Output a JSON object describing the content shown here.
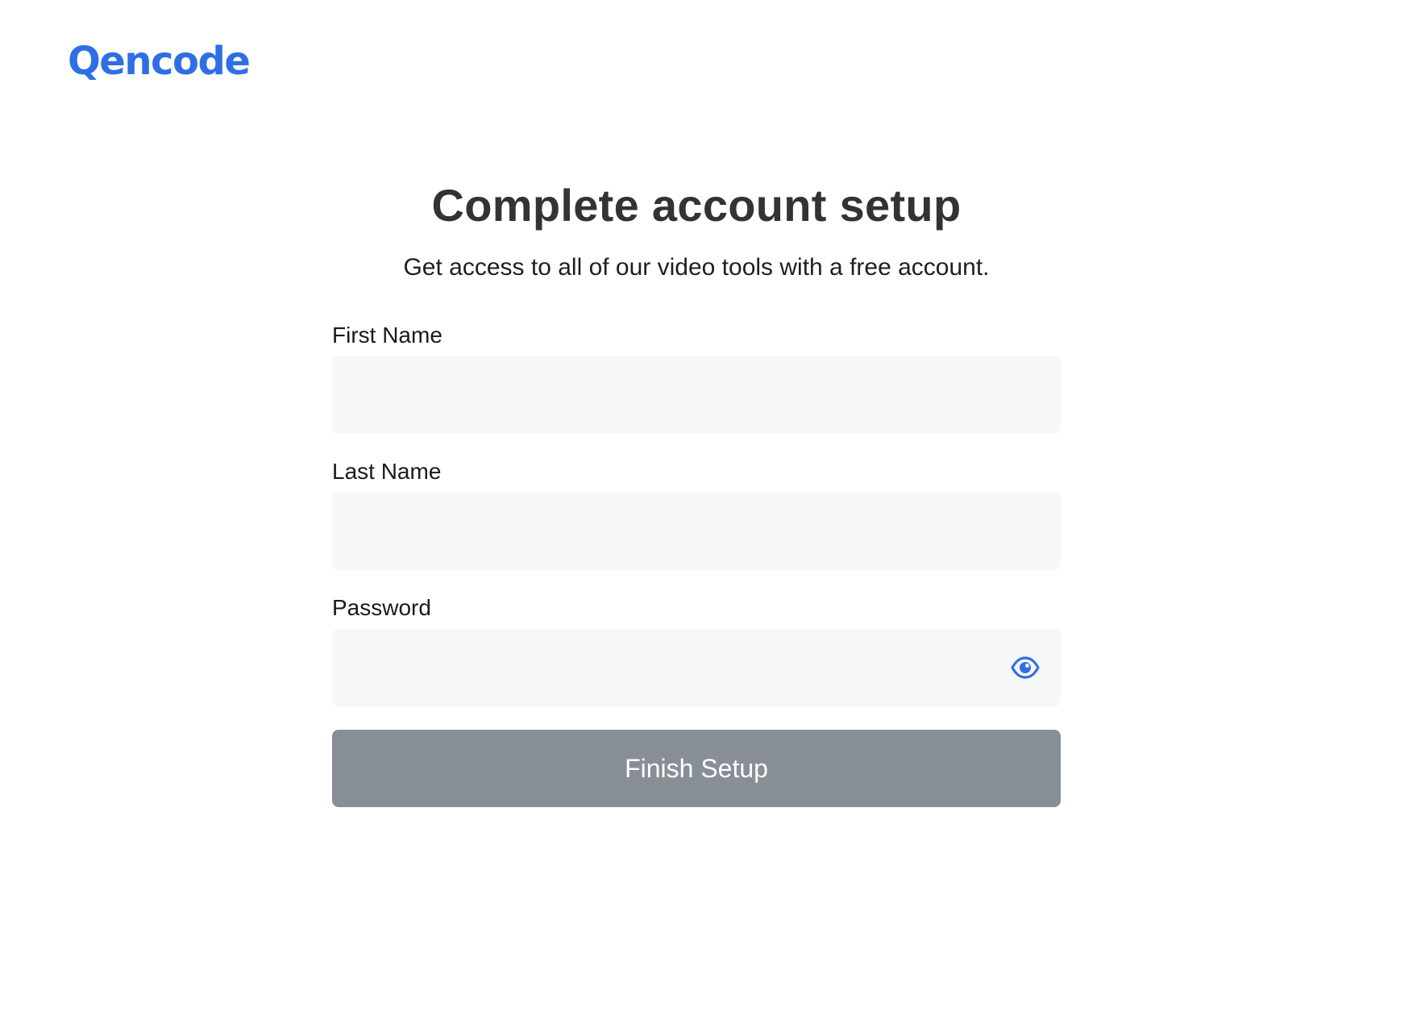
{
  "brand": {
    "logo_text": "Qencode",
    "accent_color": "#2f6fe4"
  },
  "setup": {
    "title": "Complete account setup",
    "subtitle": "Get access to all of our video tools with a free account."
  },
  "form": {
    "first_name": {
      "label": "First Name",
      "value": "",
      "placeholder": ""
    },
    "last_name": {
      "label": "Last Name",
      "value": "",
      "placeholder": ""
    },
    "password": {
      "label": "Password",
      "value": "",
      "placeholder": "",
      "toggle_icon": "eye-icon"
    },
    "submit_label": "Finish Setup",
    "submit_color": "#888e95",
    "field_background": "#f6f7f9"
  }
}
